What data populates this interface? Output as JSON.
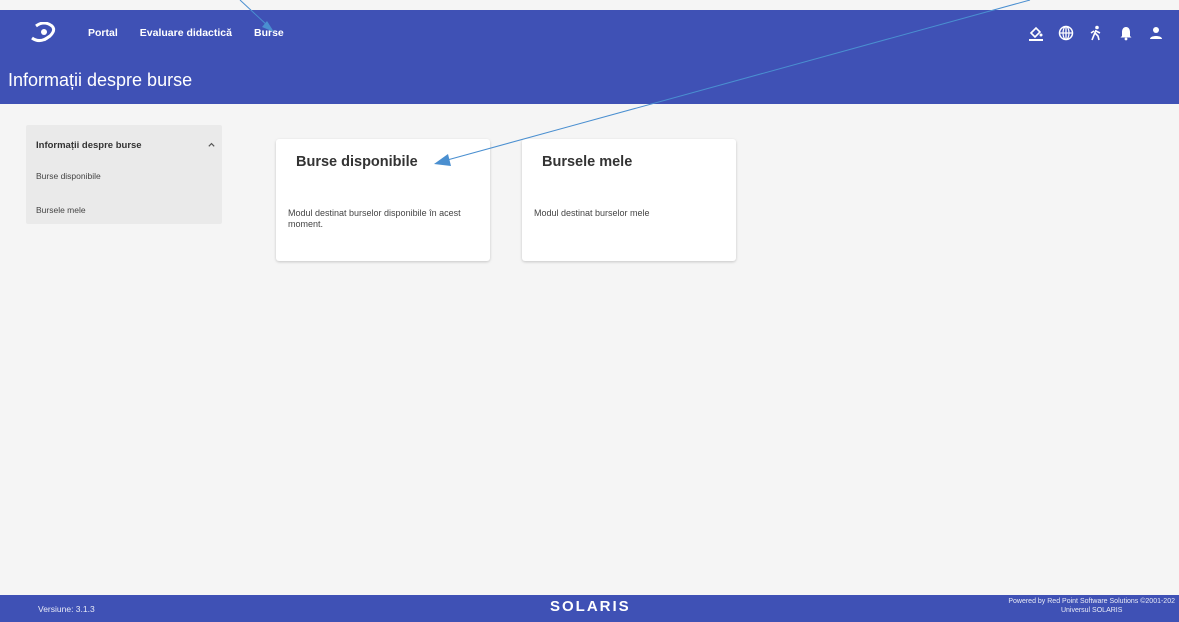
{
  "nav": {
    "items": [
      {
        "label": "Portal"
      },
      {
        "label": "Evaluare didactică"
      },
      {
        "label": "Burse"
      }
    ],
    "icons": [
      "accessibility-paint-icon",
      "globe-icon",
      "walking-person-icon",
      "bell-icon",
      "user-icon"
    ]
  },
  "page": {
    "title": "Informații despre burse"
  },
  "sidebar": {
    "header": "Informații despre burse",
    "items": [
      {
        "label": "Burse disponibile"
      },
      {
        "label": "Bursele mele"
      }
    ]
  },
  "cards": [
    {
      "title": "Burse disponibile",
      "description": "Modul destinat burselor disponibile în acest moment."
    },
    {
      "title": "Bursele mele",
      "description": "Modul destinat burselor mele"
    }
  ],
  "footer": {
    "version": "Versiune: 3.1.3",
    "brand": "SOLARIS",
    "powered_line1": "Powered by Red Point Software Solutions ©2001-202",
    "powered_line2": "Universul SOLARIS"
  },
  "colors": {
    "primary": "#3f51b5",
    "background": "#f5f5f5",
    "annotation": "#4a8fd0"
  }
}
